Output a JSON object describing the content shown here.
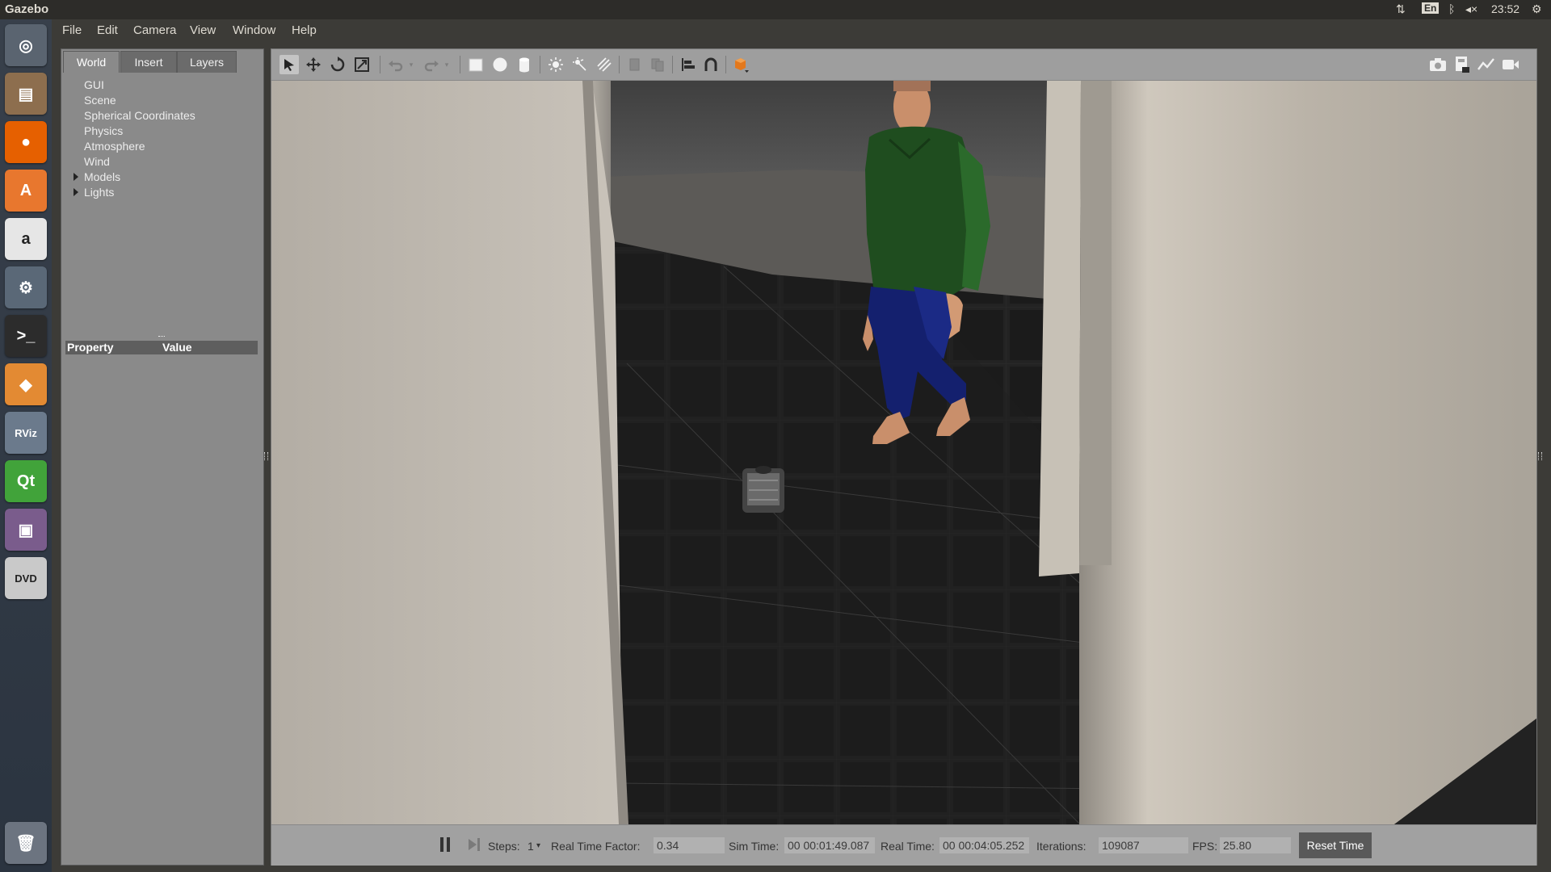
{
  "panel": {
    "app_title": "Gazebo",
    "keyboard": "En",
    "clock": "23:52",
    "network_icon": "network-icon",
    "bluetooth_icon": "bluetooth-icon",
    "sound_icon": "sound-muted-icon",
    "gear_icon": "gear-icon"
  },
  "launcher": {
    "items": [
      {
        "name": "ubuntu-dash-icon",
        "glyph": "◎",
        "bg": "#5a6470"
      },
      {
        "name": "files-icon",
        "glyph": "▤",
        "bg": "#8d6e4e"
      },
      {
        "name": "firefox-icon",
        "glyph": "●",
        "bg": "#e66000"
      },
      {
        "name": "software-center-icon",
        "glyph": "A",
        "bg": "#e8772e"
      },
      {
        "name": "amazon-icon",
        "glyph": "a",
        "bg": "#e6e6e6"
      },
      {
        "name": "system-settings-icon",
        "glyph": "⚙",
        "bg": "#5a6877"
      },
      {
        "name": "terminal-icon",
        "glyph": ">_",
        "bg": "#2c2c2c"
      },
      {
        "name": "gazebo-icon",
        "glyph": "◆",
        "bg": "#e38a33"
      },
      {
        "name": "rviz-icon",
        "glyph": "RViz",
        "bg": "#6b7a8c"
      },
      {
        "name": "qt-creator-icon",
        "glyph": "Qt",
        "bg": "#41a33a"
      },
      {
        "name": "screen-recorder-icon",
        "glyph": "▣",
        "bg": "#7a5c8c"
      },
      {
        "name": "dvd-icon",
        "glyph": "DVD",
        "bg": "#c9c9c9"
      },
      {
        "name": "trash-icon",
        "glyph": "🗑",
        "bg": "#6c7480"
      }
    ]
  },
  "menu": {
    "items": [
      "File",
      "Edit",
      "Camera",
      "View",
      "Window",
      "Help"
    ]
  },
  "left_panel": {
    "tabs": [
      "World",
      "Insert",
      "Layers"
    ],
    "active_tab": "World",
    "tree": [
      "GUI",
      "Scene",
      "Spherical Coordinates",
      "Physics",
      "Atmosphere",
      "Wind",
      "Models",
      "Lights"
    ],
    "property_header": "Property",
    "value_header": "Value"
  },
  "toolbar": {
    "left_tools": [
      "select-arrow-icon",
      "translate-icon",
      "rotate-icon",
      "scale-icon",
      "undo-icon",
      "undo-dropdown-icon",
      "redo-icon",
      "redo-dropdown-icon",
      "box-icon",
      "sphere-icon",
      "cylinder-icon",
      "point-light-icon",
      "spot-light-icon",
      "directional-light-icon",
      "copy-icon",
      "paste-icon",
      "align-icon",
      "snap-icon",
      "change-view-icon"
    ],
    "right_tools": [
      "screenshot-icon",
      "log-icon",
      "plot-icon",
      "record-video-icon"
    ]
  },
  "bottom_bar": {
    "steps_label": "Steps:",
    "steps_value": "1",
    "rtf_label": "Real Time Factor:",
    "rtf_value": "0.34",
    "sim_time_label": "Sim Time:",
    "sim_time_value": "00 00:01:49.087",
    "real_time_label": "Real Time:",
    "real_time_value": "00 00:04:05.252",
    "iterations_label": "Iterations:",
    "iterations_value": "109087",
    "fps_label": "FPS:",
    "fps_value": "25.80",
    "reset_label": "Reset Time"
  },
  "colors": {
    "panel_bg": "#8a8a8a",
    "toolbar_bg": "#9e9e9e",
    "accent_orange": "#e38a33",
    "shirt_green": "#1f5a1f",
    "pants_blue": "#142070"
  }
}
